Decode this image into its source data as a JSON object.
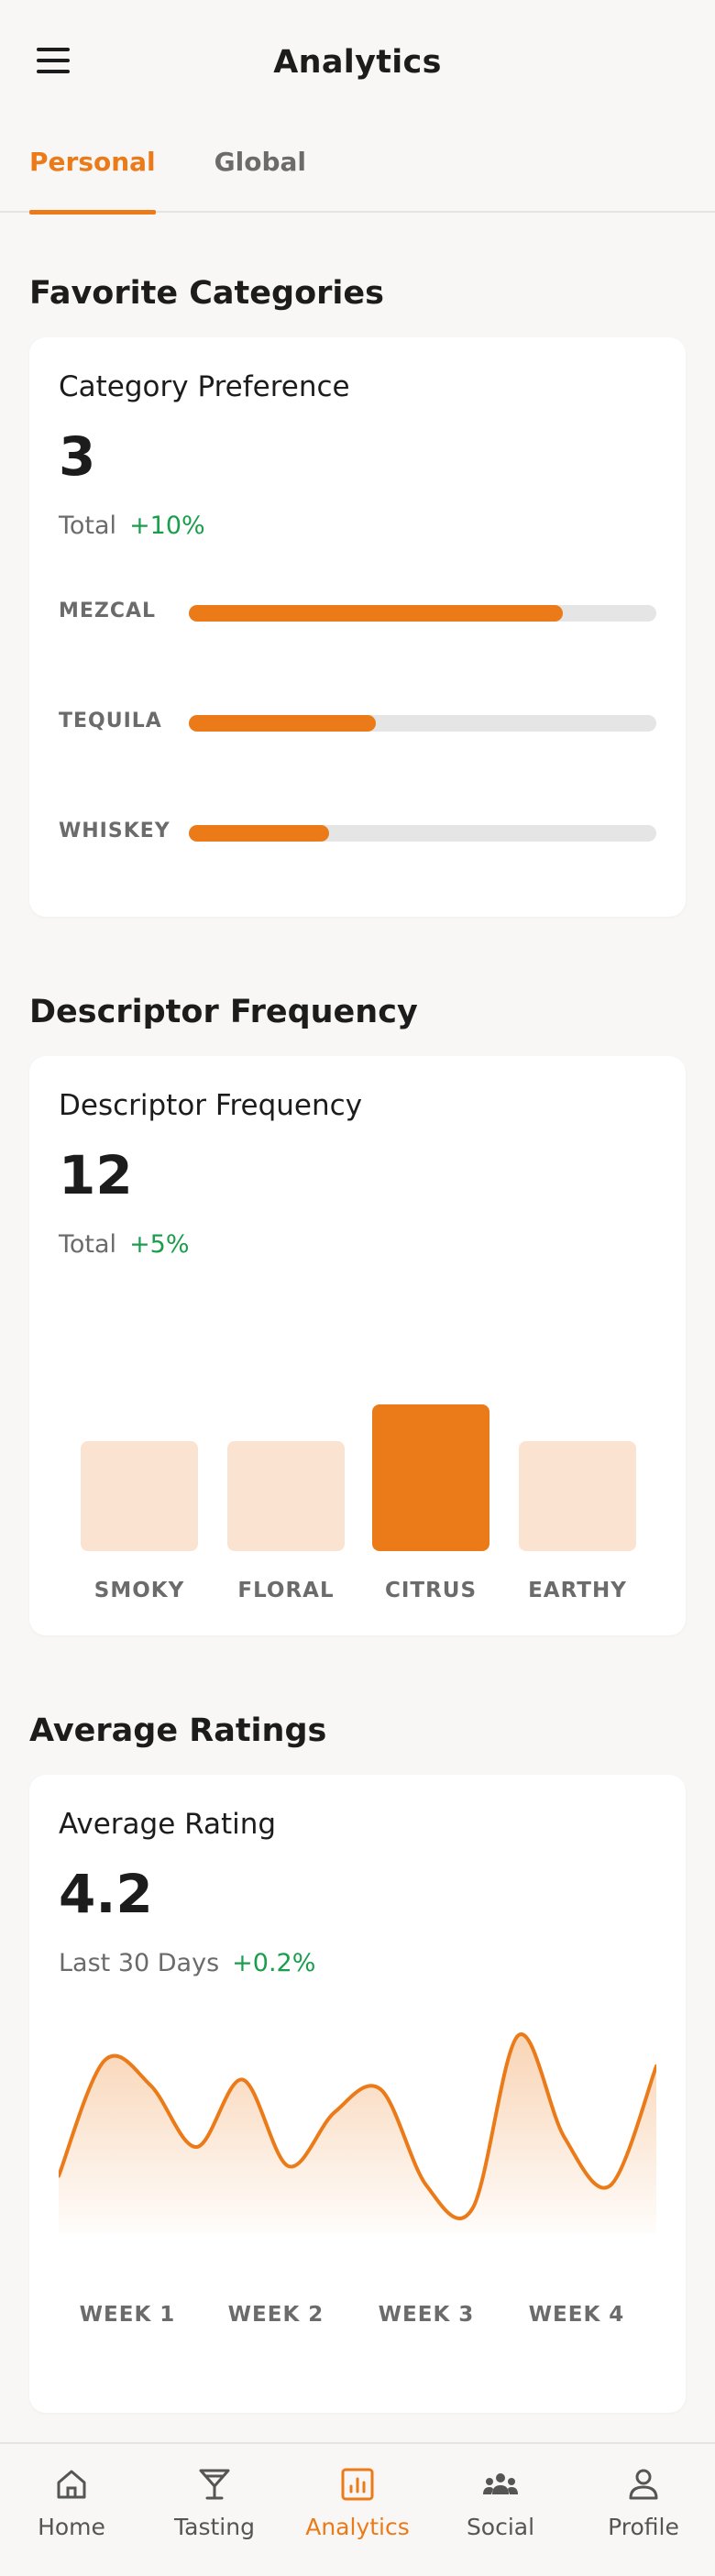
{
  "header": {
    "title": "Analytics",
    "menu_icon": "hamburger-menu-icon"
  },
  "tabs": [
    {
      "label": "Personal",
      "active": true
    },
    {
      "label": "Global",
      "active": false
    }
  ],
  "colors": {
    "accent": "#eb7a18",
    "accent_light": "#fbe3d2",
    "positive": "#1a9e4b",
    "track": "#e5e5e5"
  },
  "sections": {
    "categories": {
      "heading": "Favorite Categories",
      "card_title": "Category Preference",
      "value": "3",
      "sub_label": "Total",
      "delta": "+10%",
      "bars": [
        {
          "label": "MEZCAL",
          "fraction": 0.8
        },
        {
          "label": "TEQUILA",
          "fraction": 0.4
        },
        {
          "label": "WHISKEY",
          "fraction": 0.3
        }
      ]
    },
    "descriptors": {
      "heading": "Descriptor Frequency",
      "card_title": "Descriptor Frequency",
      "value": "12",
      "sub_label": "Total",
      "delta": "+5%",
      "columns": [
        {
          "label": "SMOKY",
          "level": 0.75,
          "highlight": false
        },
        {
          "label": "FLORAL",
          "level": 0.75,
          "highlight": false
        },
        {
          "label": "CITRUS",
          "level": 1.0,
          "highlight": true
        },
        {
          "label": "EARTHY",
          "level": 0.75,
          "highlight": false
        }
      ]
    },
    "ratings": {
      "heading": "Average Ratings",
      "card_title": "Average Rating",
      "value": "4.2",
      "sub_label": "Last 30 Days",
      "delta": "+0.2%",
      "weeks": [
        "WEEK 1",
        "WEEK 2",
        "WEEK 3",
        "WEEK 4"
      ],
      "series": [
        0.25,
        0.85,
        0.72,
        0.4,
        0.75,
        0.3,
        0.58,
        0.7,
        0.2,
        0.08,
        0.98,
        0.45,
        0.2,
        0.82
      ]
    }
  },
  "bottom_nav": [
    {
      "label": "Home",
      "icon": "home-icon",
      "active": false
    },
    {
      "label": "Tasting",
      "icon": "cocktail-glass-icon",
      "active": false
    },
    {
      "label": "Analytics",
      "icon": "analytics-chart-icon",
      "active": true
    },
    {
      "label": "Social",
      "icon": "people-group-icon",
      "active": false
    },
    {
      "label": "Profile",
      "icon": "user-profile-icon",
      "active": false
    }
  ]
}
